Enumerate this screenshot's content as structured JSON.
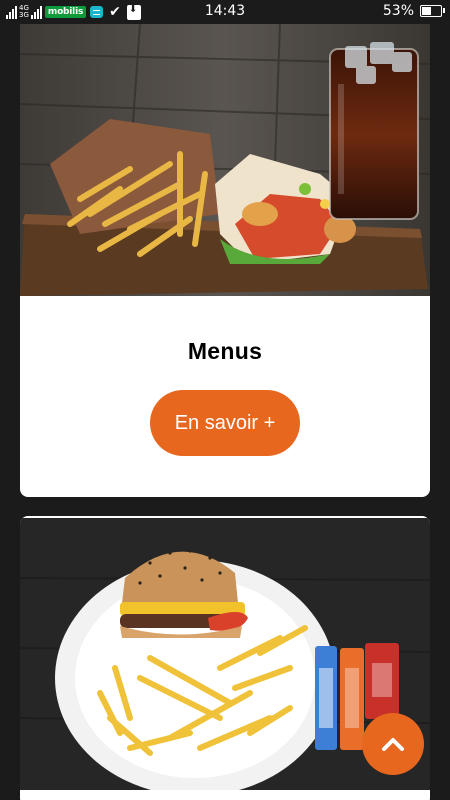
{
  "status_bar": {
    "network_label_top": "4G",
    "network_label_bottom": "3G",
    "operator": "mobilis",
    "time": "14:43",
    "battery_percent": "53%",
    "battery_level": 0.53
  },
  "cards": [
    {
      "title": "Menus",
      "button_label": "En savoir +"
    },
    {
      "title": ""
    }
  ],
  "scroll_top": {
    "icon": "chevron-up-icon"
  },
  "colors": {
    "accent": "#e8671f",
    "background": "#1b1b1b",
    "card": "#ffffff"
  }
}
